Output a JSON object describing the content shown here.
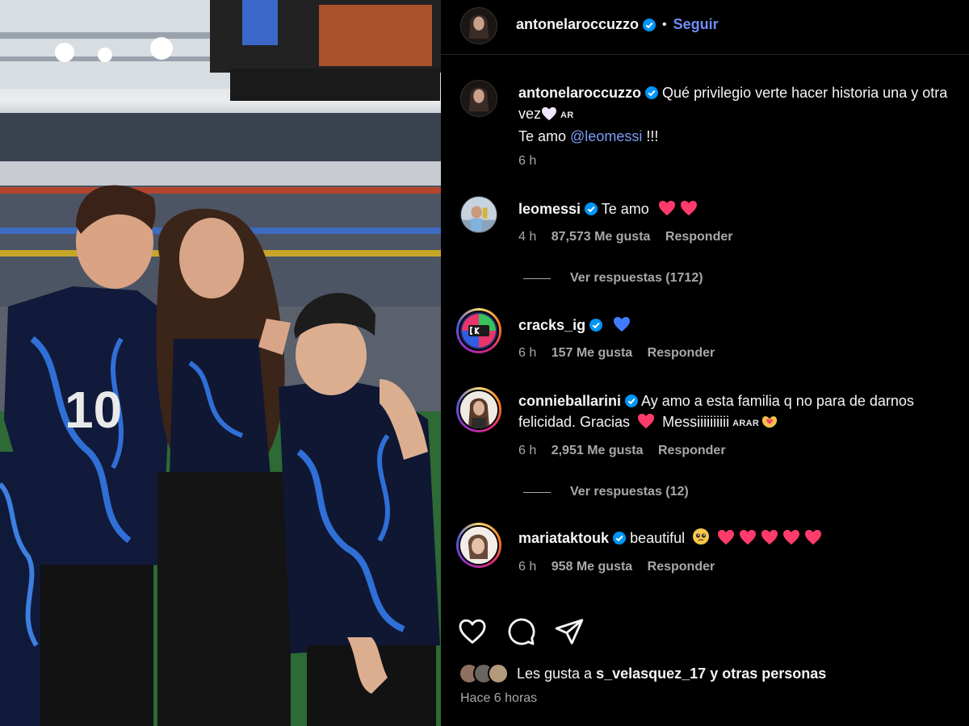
{
  "post": {
    "author": "antonelaroccuzzo",
    "follow_dot": "•",
    "follow_label": "Seguir",
    "caption": {
      "username": "antonelaroccuzzo",
      "line1": "Qué privilegio verte hacer historia una y otra vez",
      "flag": "AR",
      "line2_prefix": "Te amo ",
      "mention": "@leomessi",
      "line2_suffix": " !!!",
      "time": "6 h"
    }
  },
  "comments": [
    {
      "username": "leomessi",
      "text": "Te amo",
      "hearts": 2,
      "time": "4 h",
      "likes": "87,573 Me gusta",
      "reply": "Responder",
      "view_replies": "Ver respuestas (1712)"
    },
    {
      "username": "cracks_ig",
      "text": "",
      "blue_heart": true,
      "time": "6 h",
      "likes": "157 Me gusta",
      "reply": "Responder"
    },
    {
      "username": "connieballarini",
      "text_line1": "Ay amo a esta familia q no para de darnos",
      "text_line2_a": "felicidad. Gracias",
      "text_line2_b": "Messiiiiiiiiii",
      "flags": "ARAR",
      "time": "6 h",
      "likes": "2,951 Me gusta",
      "reply": "Responder",
      "view_replies": "Ver respuestas (12)"
    },
    {
      "username": "mariataktouk",
      "text": "beautiful",
      "hearts": 5,
      "time": "6 h",
      "likes": "958 Me gusta",
      "reply": "Responder"
    }
  ],
  "icons": {
    "like": "heart-outline-icon",
    "comment": "comment-bubble-icon",
    "share": "paper-plane-icon",
    "verified": "verified-badge-icon"
  },
  "likes": {
    "prefix": "Les gusta a ",
    "user": "s_velasquez_17",
    "suffix": " y otras personas"
  },
  "posted_ago": "Hace 6 horas",
  "colors": {
    "background": "#000000",
    "verified": "#0095f6",
    "link": "#7f9bf7",
    "heart_red": "#ff3b5c",
    "heart_blue": "#3f7cff",
    "muted": "#a8a8a8"
  }
}
